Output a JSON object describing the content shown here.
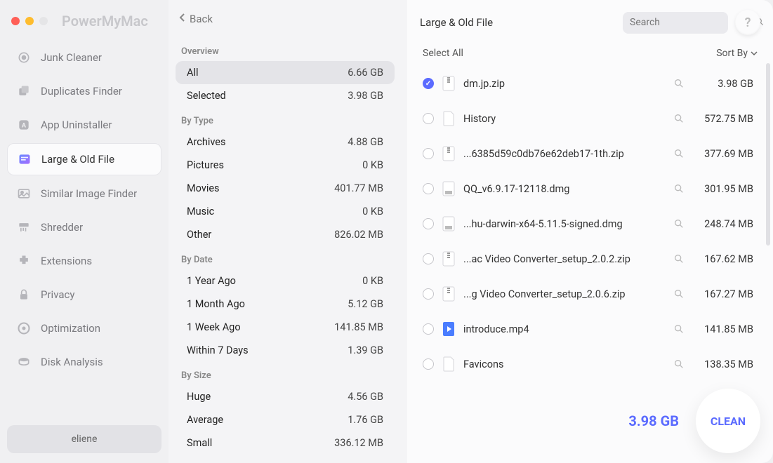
{
  "app_name": "PowerMyMac",
  "back_label": "Back",
  "sidebar": {
    "items": [
      {
        "label": "Junk Cleaner"
      },
      {
        "label": "Duplicates Finder"
      },
      {
        "label": "App Uninstaller"
      },
      {
        "label": "Large & Old File"
      },
      {
        "label": "Similar Image Finder"
      },
      {
        "label": "Shredder"
      },
      {
        "label": "Extensions"
      },
      {
        "label": "Privacy"
      },
      {
        "label": "Optimization"
      },
      {
        "label": "Disk Analysis"
      }
    ],
    "user": "eliene"
  },
  "filters": {
    "overview_title": "Overview",
    "overview": [
      {
        "label": "All",
        "value": "6.66 GB"
      },
      {
        "label": "Selected",
        "value": "3.98 GB"
      }
    ],
    "by_type_title": "By Type",
    "by_type": [
      {
        "label": "Archives",
        "value": "4.88 GB"
      },
      {
        "label": "Pictures",
        "value": "0 KB"
      },
      {
        "label": "Movies",
        "value": "401.77 MB"
      },
      {
        "label": "Music",
        "value": "0 KB"
      },
      {
        "label": "Other",
        "value": "826.02 MB"
      }
    ],
    "by_date_title": "By Date",
    "by_date": [
      {
        "label": "1 Year Ago",
        "value": "0 KB"
      },
      {
        "label": "1 Month Ago",
        "value": "5.12 GB"
      },
      {
        "label": "1 Week Ago",
        "value": "141.85 MB"
      },
      {
        "label": "Within 7 Days",
        "value": "1.39 GB"
      }
    ],
    "by_size_title": "By Size",
    "by_size": [
      {
        "label": "Huge",
        "value": "4.56 GB"
      },
      {
        "label": "Average",
        "value": "1.76 GB"
      },
      {
        "label": "Small",
        "value": "336.12 MB"
      }
    ]
  },
  "right": {
    "title": "Large & Old File",
    "search_placeholder": "Search",
    "help": "?",
    "select_all": "Select All",
    "sort_by": "Sort By",
    "total_selected": "3.98 GB",
    "clean_label": "CLEAN"
  },
  "files": [
    {
      "name": "dm.jp.zip",
      "size": "3.98 GB",
      "checked": true,
      "icon": "zip"
    },
    {
      "name": "History",
      "size": "572.75 MB",
      "checked": false,
      "icon": "file"
    },
    {
      "name": "...6385d59c0db76e62deb17-1th.zip",
      "size": "377.69 MB",
      "checked": false,
      "icon": "zip"
    },
    {
      "name": "QQ_v6.9.17-12118.dmg",
      "size": "301.95 MB",
      "checked": false,
      "icon": "dmg"
    },
    {
      "name": "...hu-darwin-x64-5.11.5-signed.dmg",
      "size": "248.74 MB",
      "checked": false,
      "icon": "dmg"
    },
    {
      "name": "...ac Video Converter_setup_2.0.2.zip",
      "size": "167.62 MB",
      "checked": false,
      "icon": "zip"
    },
    {
      "name": "...g Video Converter_setup_2.0.6.zip",
      "size": "167.27 MB",
      "checked": false,
      "icon": "zip"
    },
    {
      "name": "introduce.mp4",
      "size": "141.85 MB",
      "checked": false,
      "icon": "mp4"
    },
    {
      "name": "Favicons",
      "size": "138.35 MB",
      "checked": false,
      "icon": "file"
    }
  ]
}
